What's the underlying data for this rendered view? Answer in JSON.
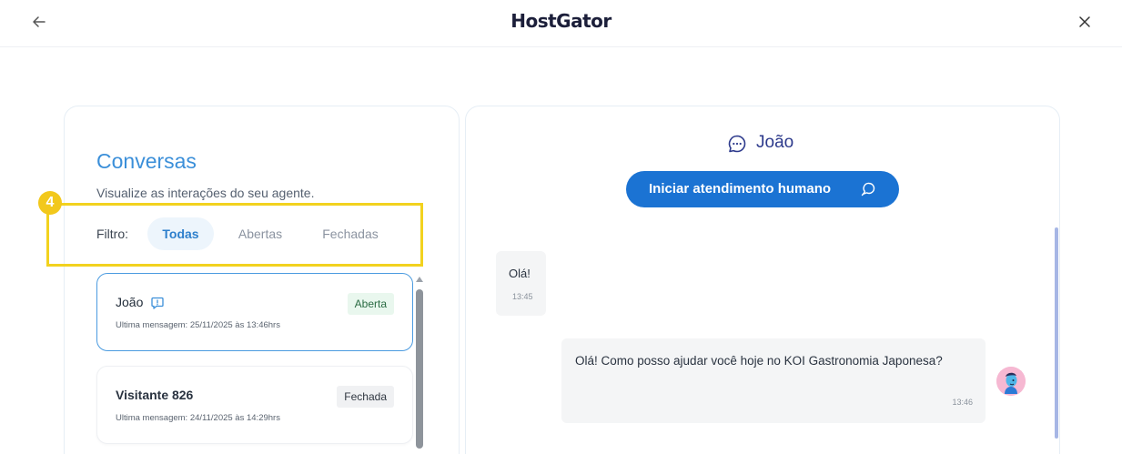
{
  "header": {
    "logo": "HostGator"
  },
  "conversations": {
    "title": "Conversas",
    "subtitle": "Visualize as interações do seu agente.",
    "step_number": "4",
    "filter": {
      "label": "Filtro:",
      "options": [
        "Todas",
        "Abertas",
        "Fechadas"
      ],
      "selected": "Todas"
    },
    "items": [
      {
        "name": "João",
        "last_message": "Ultima mensagem: 25/11/2025 às 13:46hrs",
        "status": "Aberta"
      },
      {
        "name": "Visitante 826",
        "last_message": "Ultima mensagem: 24/11/2025 às 14:29hrs",
        "status": "Fechada"
      }
    ]
  },
  "chat": {
    "title": "João",
    "human_button_label": "Iniciar atendimento humano",
    "messages": [
      {
        "text": "Olá!",
        "time": "13:45"
      },
      {
        "text": "Olá! Como posso ajudar você hoje no KOI Gastronomia Japonesa?",
        "time": "13:46"
      }
    ]
  },
  "colors": {
    "accent": "#1b73d3",
    "title_blue": "#3b8fd9",
    "highlight": "#f2d21e",
    "open_badge_bg": "#e9f7ee"
  }
}
